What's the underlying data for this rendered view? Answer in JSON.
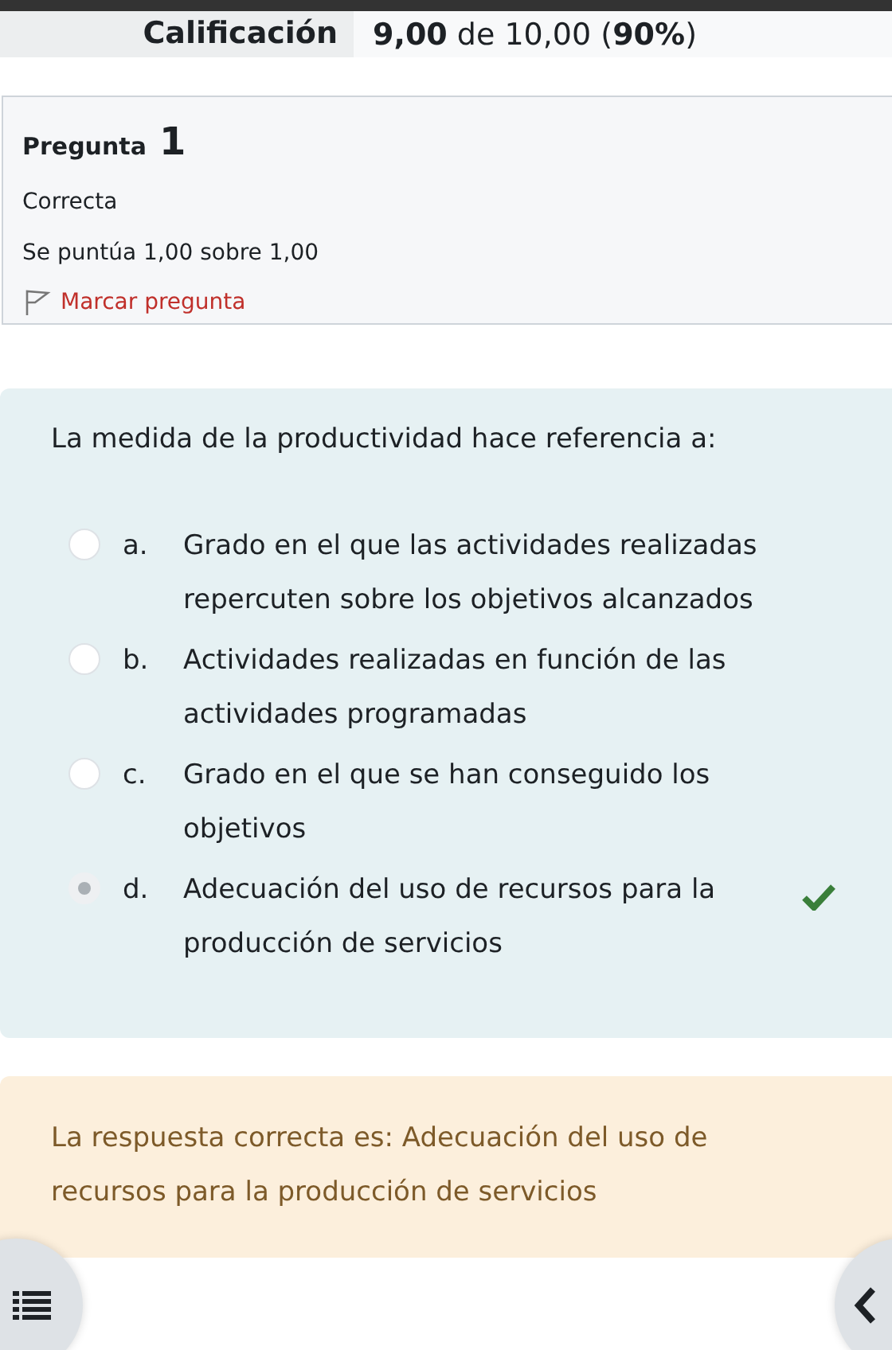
{
  "grade": {
    "label": "Calificación",
    "value": "**9,00** de 10,00 (**90%**)"
  },
  "info": {
    "title": "Pregunta",
    "number": "1",
    "state": "Correcta",
    "score": "Se puntúa 1,00 sobre 1,00",
    "flag": "Marcar pregunta"
  },
  "question": {
    "text": "La medida de la productividad hace referencia a:",
    "options": [
      {
        "letter": "a.",
        "text": "Grado en el que las actividades realizadas repercuten sobre los objetivos alcanzados",
        "selected": false,
        "correct": false
      },
      {
        "letter": "b.",
        "text": "Actividades realizadas en función de las actividades programadas",
        "selected": false,
        "correct": false
      },
      {
        "letter": "c.",
        "text": "Grado en el que se han conseguido los objetivos",
        "selected": false,
        "correct": false
      },
      {
        "letter": "d.",
        "text": "Adecuación del uso de recursos para la producción de servicios",
        "selected": true,
        "correct": true
      }
    ]
  },
  "feedback": {
    "text": "La respuesta correcta es: Adecuación del uso de recursos para la producción de servicios"
  }
}
